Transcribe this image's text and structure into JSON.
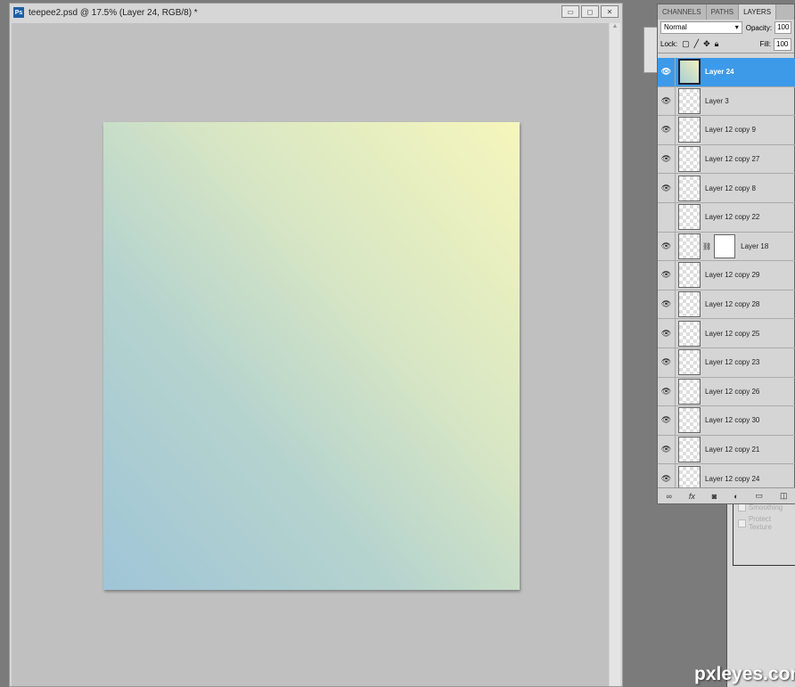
{
  "document": {
    "title": "teepee2.psd @ 17.5% (Layer 24, RGB/8) *",
    "app_icon": "Ps",
    "window_buttons": {
      "minimize": "▭",
      "restore": "◻",
      "close": "✕"
    }
  },
  "panel": {
    "tabs": [
      "CHANNELS",
      "PATHS",
      "LAYERS"
    ],
    "active_tab": "LAYERS",
    "blend_mode": "Normal",
    "opacity_label": "Opacity:",
    "opacity_value": "100",
    "lock_label": "Lock:",
    "fill_label": "Fill:",
    "fill_value": "100",
    "layers": [
      {
        "name": "Layer 24",
        "visible": true,
        "selected": true
      },
      {
        "name": "Layer 3",
        "visible": true
      },
      {
        "name": "Layer 12 copy 9",
        "visible": true
      },
      {
        "name": "Layer 12 copy 27",
        "visible": true
      },
      {
        "name": "Layer 12 copy 8",
        "visible": true
      },
      {
        "name": "Layer 12 copy 22",
        "visible": false
      },
      {
        "name": "Layer 18",
        "visible": true,
        "mask": true
      },
      {
        "name": "Layer 12 copy 29",
        "visible": true
      },
      {
        "name": "Layer 12 copy 28",
        "visible": true
      },
      {
        "name": "Layer 12 copy 25",
        "visible": true
      },
      {
        "name": "Layer 12 copy 23",
        "visible": true
      },
      {
        "name": "Layer 12 copy 26",
        "visible": true
      },
      {
        "name": "Layer 12 copy 30",
        "visible": true
      },
      {
        "name": "Layer 12 copy 21",
        "visible": true
      },
      {
        "name": "Layer 12 copy 24",
        "visible": true
      }
    ]
  },
  "behind_panel": {
    "options": [
      "Smoothing",
      "Protect Texture"
    ]
  },
  "watermark": "pxleyes.com"
}
